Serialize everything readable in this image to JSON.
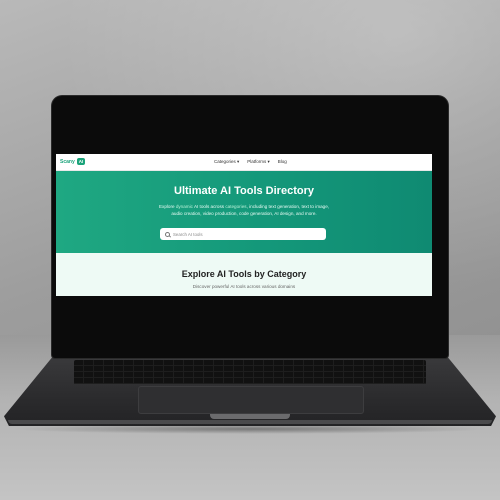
{
  "colors": {
    "accent": "#1aa37a",
    "hero_start": "#1fa882",
    "hero_end": "#0f8a72",
    "section_bg": "#eefaf5"
  },
  "nav": {
    "brand": "Scany",
    "brand_badge": "AI",
    "links": [
      {
        "label": "Categories ▾"
      },
      {
        "label": "Platforms ▾"
      },
      {
        "label": "Blog"
      }
    ]
  },
  "hero": {
    "title": "Ultimate AI Tools Directory",
    "subtitle_start": "Explore ",
    "subtitle_hl1": "dynamic",
    "subtitle_mid": " AI tools across ",
    "subtitle_hl2": "categories",
    "subtitle_end": ", including text generation, text to image, audio creation, video production, code generation, AI design, and more.",
    "search": {
      "placeholder": "Search AI tools",
      "icon": "search-icon"
    }
  },
  "section": {
    "title": "Explore AI Tools by Category",
    "subtitle": "Discover powerful AI tools across various domains"
  }
}
